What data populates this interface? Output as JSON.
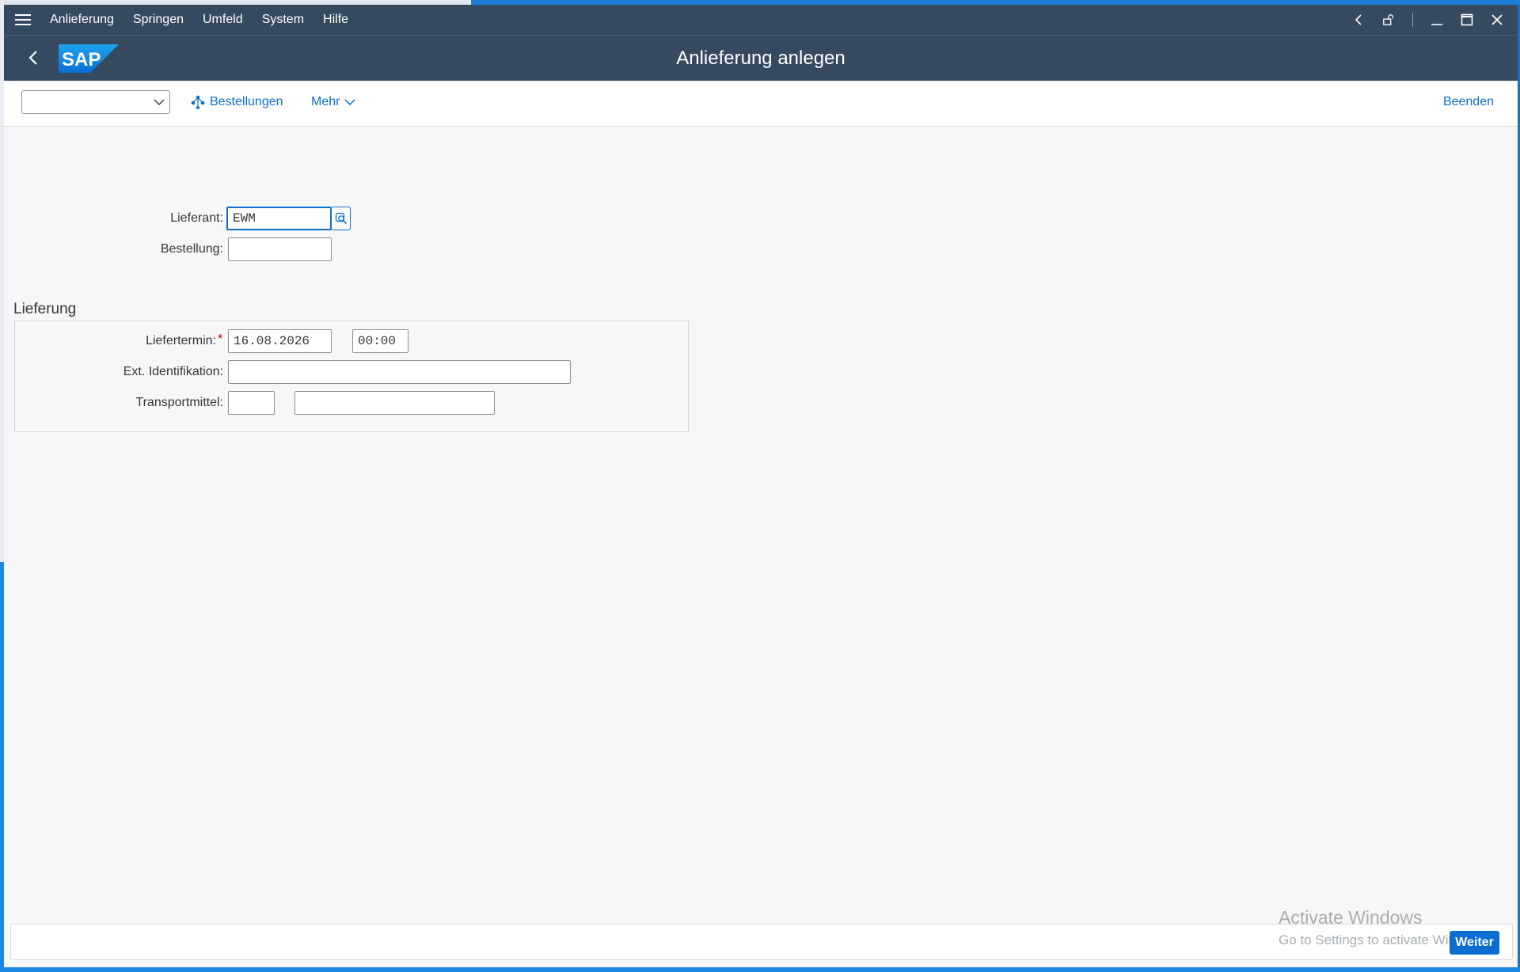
{
  "menubar": {
    "items": [
      "Anlieferung",
      "Springen",
      "Umfeld",
      "System",
      "Hilfe"
    ]
  },
  "shell": {
    "logo_text": "SAP",
    "title": "Anlieferung anlegen"
  },
  "toolbar": {
    "tcode_value": "",
    "orders_label": "Bestellungen",
    "more_label": "Mehr",
    "end_label": "Beenden"
  },
  "form": {
    "supplier_label": "Lieferant:",
    "supplier_value": "EWM",
    "order_label": "Bestellung:",
    "order_value": ""
  },
  "delivery": {
    "section_title": "Lieferung",
    "date_label": "Liefertermin:",
    "required_marker": "*",
    "date_value": "16.08.2026",
    "time_value": "00:00",
    "ext_id_label": "Ext. Identifikation:",
    "ext_id_value": "",
    "transport_label": "Transportmittel:",
    "transport_code_value": "",
    "transport_desc_value": ""
  },
  "statusbar": {
    "message": "",
    "continue_label": "Weiter"
  },
  "watermark": {
    "title": "Activate Windows",
    "subtitle": "Go to Settings to activate Windows."
  },
  "colors": {
    "shell_bg": "#354a5f",
    "accent": "#0a6ed1",
    "required": "#bb0000"
  }
}
